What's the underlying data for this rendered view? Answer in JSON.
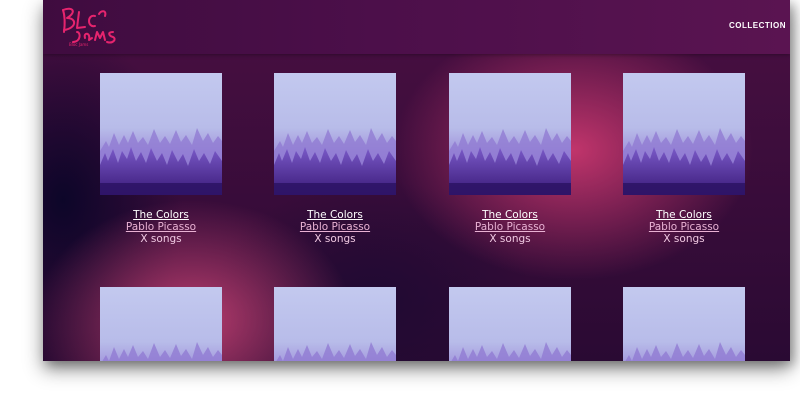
{
  "app": {
    "logo_text": "Bloc Jams"
  },
  "nav": {
    "collection_label": "COLLECTION"
  },
  "albums": [
    {
      "title": "The Colors",
      "artist": "Pablo Picasso",
      "song_count": "X songs"
    },
    {
      "title": "The Colors",
      "artist": "Pablo Picasso",
      "song_count": "X songs"
    },
    {
      "title": "The Colors",
      "artist": "Pablo Picasso",
      "song_count": "X songs"
    },
    {
      "title": "The Colors",
      "artist": "Pablo Picasso",
      "song_count": "X songs"
    },
    {
      "title": "",
      "artist": "",
      "song_count": ""
    },
    {
      "title": "",
      "artist": "",
      "song_count": ""
    },
    {
      "title": "",
      "artist": "",
      "song_count": ""
    },
    {
      "title": "",
      "artist": "",
      "song_count": ""
    }
  ],
  "colors": {
    "header_bg": "#4c0f4a",
    "logo_pink": "#e6246e",
    "artist_link": "#e9b2d4"
  },
  "icons": {
    "cover_art": "misty-purple-forest-image"
  }
}
